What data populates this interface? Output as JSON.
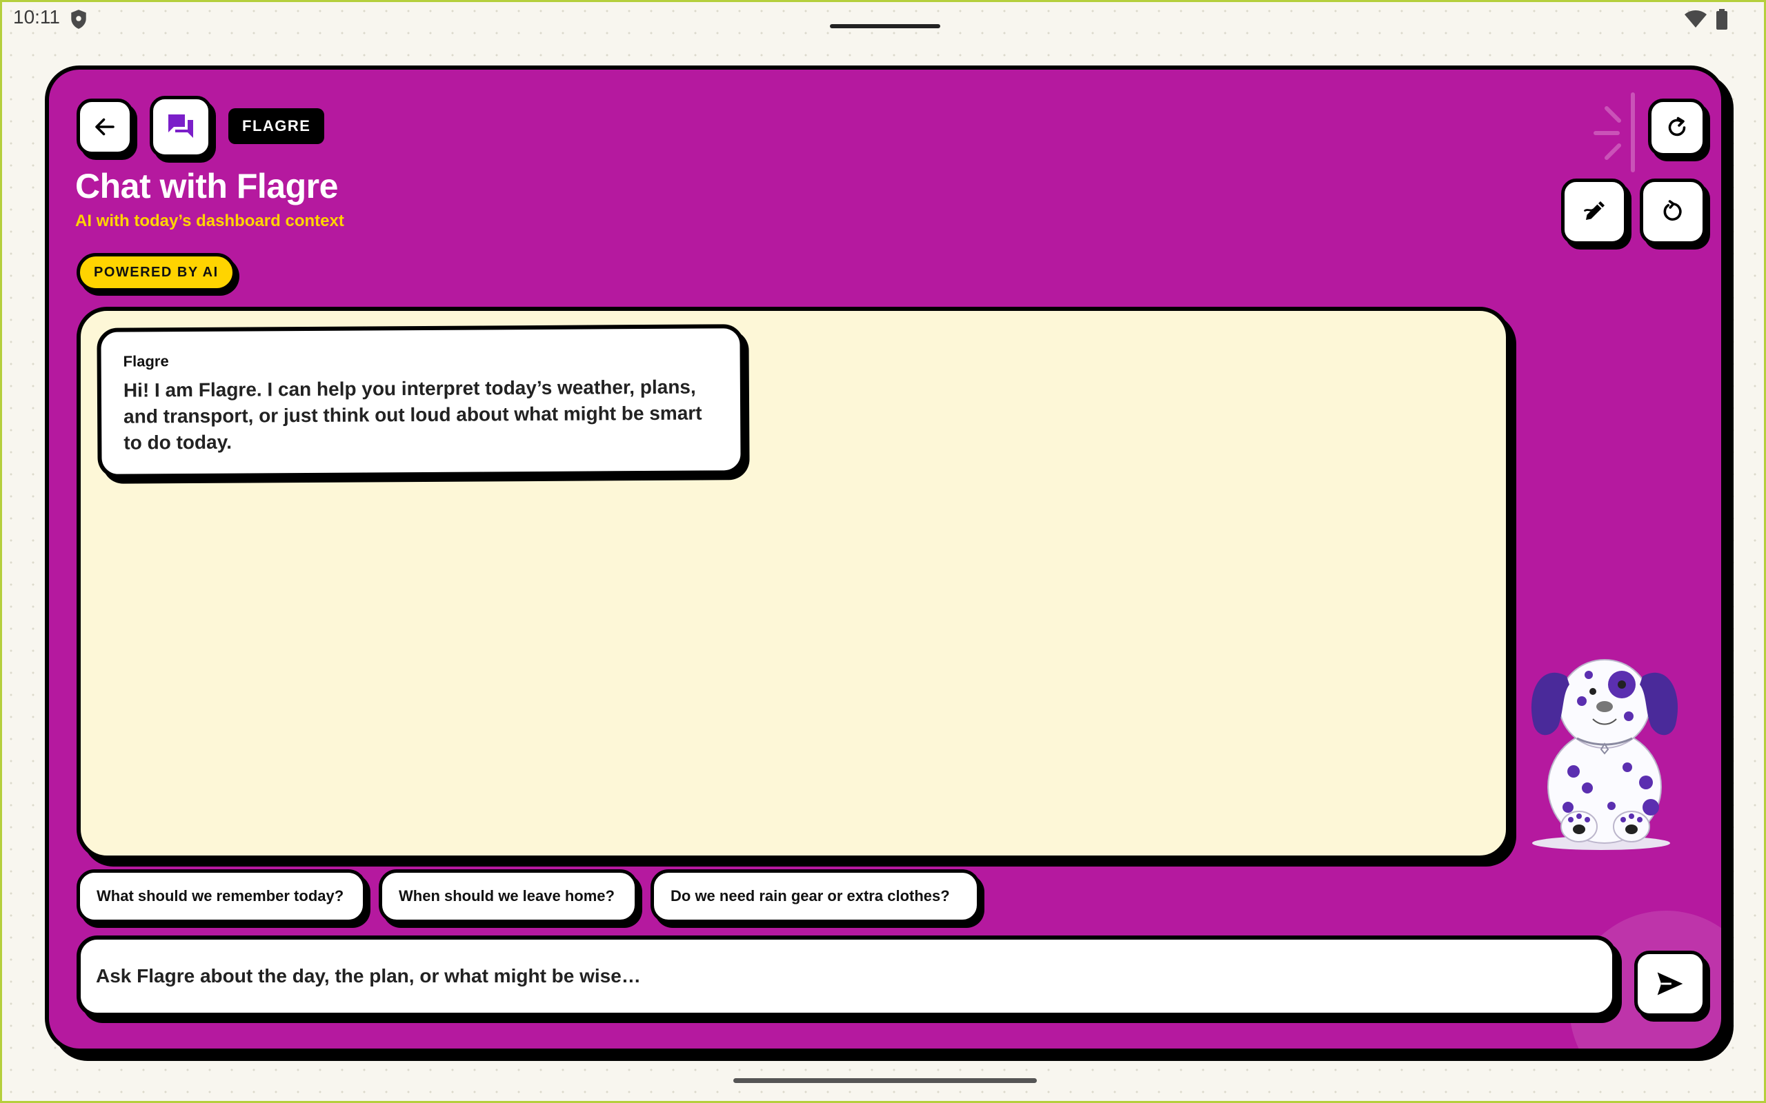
{
  "status_bar": {
    "time": "10:11"
  },
  "header": {
    "tag": "FLAGRE",
    "title": "Chat with Flagre",
    "subtitle": "AI with today’s dashboard context",
    "powered_label": "POWERED BY AI"
  },
  "messages": [
    {
      "author": "Flagre",
      "text": "Hi! I am Flagre. I can help you interpret today’s weather, plans, and transport, or just think out loud about what might be smart to do today."
    }
  ],
  "suggestions": [
    "What should we remember today?",
    "When should we leave home?",
    "Do we need rain gear or extra clothes?"
  ],
  "composer": {
    "placeholder": "Ask Flagre about the day, the plan, or what might be wise…"
  },
  "icons": {
    "back": "arrow-left-icon",
    "chat": "chat-bubbles-icon",
    "refresh": "refresh-icon",
    "edit": "edit-pen-icon",
    "reset": "reset-icon",
    "send": "send-icon"
  },
  "colors": {
    "card": "#b5199f",
    "chat_bg": "#fdf7d7",
    "accent_yellow": "#ffd400",
    "chat_icon": "#7b1fc9"
  }
}
